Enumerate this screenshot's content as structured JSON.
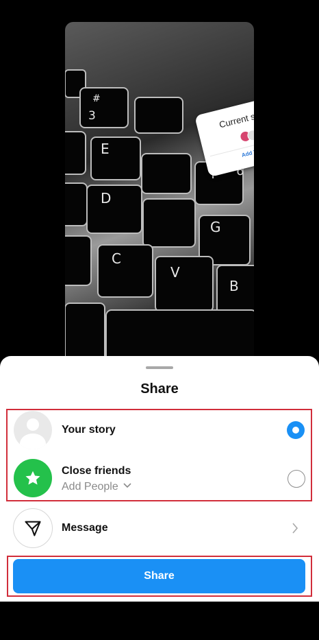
{
  "story_preview": {
    "sticker_title": "Current status",
    "sticker_action": "Add Yours"
  },
  "sheet": {
    "title": "Share",
    "options": [
      {
        "label": "Your story",
        "selected": true
      },
      {
        "label": "Close friends",
        "sublabel": "Add People",
        "selected": false
      },
      {
        "label": "Message"
      }
    ],
    "share_button_label": "Share"
  },
  "colors": {
    "accent_blue": "#1a90f5",
    "close_friends_green": "#24c14b",
    "highlight_red": "#d12d3a"
  },
  "icons": [
    "star-icon",
    "send-icon",
    "chevron-right-icon",
    "chevron-down-icon",
    "person-avatar-icon"
  ]
}
